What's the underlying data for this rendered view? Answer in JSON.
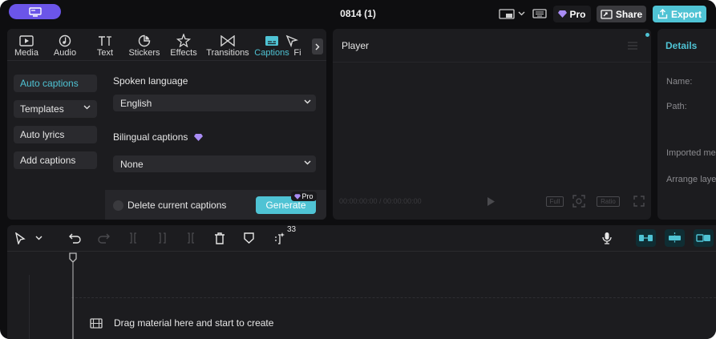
{
  "titlebar": {
    "doc_title": "0814 (1)",
    "pro_label": "Pro",
    "share_label": "Share",
    "export_label": "Export"
  },
  "tool_tabs": [
    {
      "label": "Media",
      "icon": "media-icon"
    },
    {
      "label": "Audio",
      "icon": "audio-icon"
    },
    {
      "label": "Text",
      "icon": "text-icon"
    },
    {
      "label": "Stickers",
      "icon": "stickers-icon"
    },
    {
      "label": "Effects",
      "icon": "effects-icon"
    },
    {
      "label": "Transitions",
      "icon": "transitions-icon"
    },
    {
      "label": "Captions",
      "icon": "captions-icon",
      "active": true
    },
    {
      "label": "Fi",
      "icon": "filters-icon"
    }
  ],
  "captions_menu": {
    "items": [
      "Auto captions",
      "Templates",
      "Auto lyrics",
      "Add captions"
    ],
    "active": "Auto captions"
  },
  "captions_form": {
    "spoken_language_label": "Spoken language",
    "spoken_language_value": "English",
    "bilingual_label": "Bilingual captions",
    "bilingual_value": "None",
    "delete_label": "Delete current captions",
    "generate_label": "Generate",
    "generate_pro": "Pro"
  },
  "player": {
    "title": "Player",
    "time": "00:00:00:00 / 00:00:00:00",
    "controls": [
      "Full",
      "Ratio"
    ]
  },
  "details": {
    "title": "Details",
    "rows": [
      "Name:",
      "Path:",
      "Imported me",
      "Arrange laye"
    ]
  },
  "timeline": {
    "clip_count": "33",
    "drag_hint": "Drag material here and start to create"
  },
  "colors": {
    "accent": "#4fc3d4",
    "home_button": "#6b55e8",
    "panel": "#1c1c1f",
    "background": "#0e0e10"
  }
}
